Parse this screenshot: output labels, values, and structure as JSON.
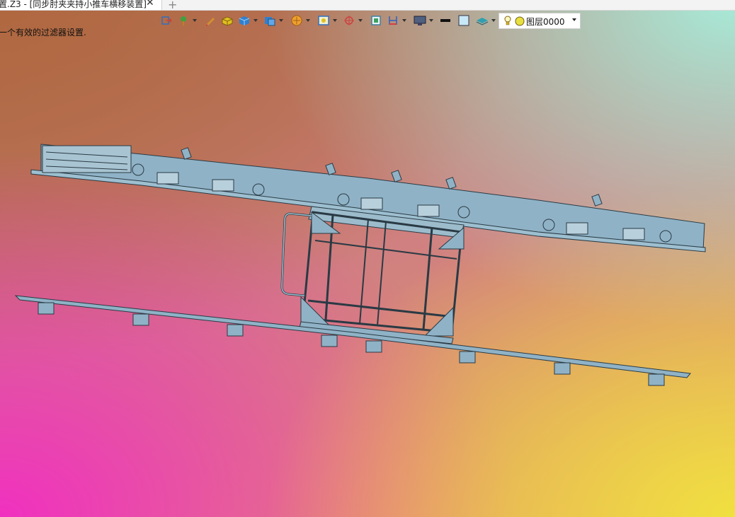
{
  "tab": {
    "title": "置.Z3 - [同步肘夹夹持小推车横移装置]",
    "close_glyph": "✕",
    "add_glyph": "+"
  },
  "toolbar": {
    "tools": [
      {
        "icon": "exit-icon",
        "color": "#d04030"
      },
      {
        "icon": "pin-icon",
        "color": "#40a040",
        "dropdown": true
      },
      {
        "icon": "pencil-icon",
        "color": "#d09030"
      },
      {
        "icon": "box-yellow-icon",
        "color": "#e0c020"
      },
      {
        "icon": "cube-icon",
        "color": "#3080d0",
        "dropdown": true
      },
      {
        "icon": "cube-stack-icon",
        "color": "#3080d0",
        "dropdown": true
      },
      {
        "icon": "render-icon",
        "color": "#e09020",
        "dropdown": true
      },
      {
        "icon": "display-icon",
        "color": "#3070c0",
        "dropdown": true
      },
      {
        "icon": "axis-icon",
        "color": "#d04040",
        "dropdown": true
      },
      {
        "icon": "frame-icon",
        "color": "#4080a0"
      },
      {
        "icon": "dimension-icon",
        "color": "#3060c0",
        "dropdown": true
      },
      {
        "icon": "monitor-icon",
        "color": "#404060",
        "dropdown": true
      },
      {
        "icon": "line-weight-icon",
        "color": "#111111"
      },
      {
        "icon": "color-swatch-icon",
        "color": "#c8e8f8"
      },
      {
        "icon": "layers-icon",
        "color": "#30a0b0",
        "dropdown": true
      }
    ]
  },
  "layer": {
    "label": "图层0000",
    "bulb_color": "#f0d020",
    "dot_color": "#e8e040"
  },
  "status": {
    "message": "一个有效的过滤器设置."
  },
  "colors": {
    "part_fill": "#8fb2c6",
    "part_stroke": "#2a3a44"
  }
}
